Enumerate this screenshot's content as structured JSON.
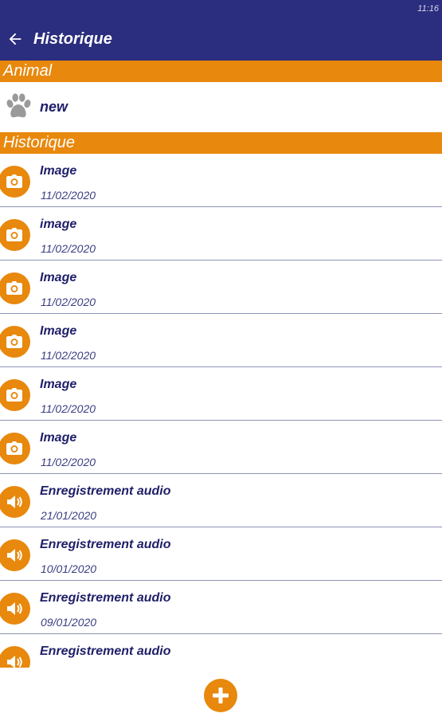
{
  "status_bar": {
    "time": "11:16"
  },
  "app_bar": {
    "title": "Historique"
  },
  "sections": {
    "animal": "Animal",
    "history": "Historique"
  },
  "animal": {
    "name": "new",
    "icon": "paw-icon"
  },
  "history": [
    {
      "type": "image",
      "icon": "camera-icon",
      "title": "Image",
      "date": "11/02/2020"
    },
    {
      "type": "image",
      "icon": "camera-icon",
      "title": "image",
      "date": "11/02/2020"
    },
    {
      "type": "image",
      "icon": "camera-icon",
      "title": "Image",
      "date": "11/02/2020"
    },
    {
      "type": "image",
      "icon": "camera-icon",
      "title": "Image",
      "date": "11/02/2020"
    },
    {
      "type": "image",
      "icon": "camera-icon",
      "title": "Image",
      "date": "11/02/2020"
    },
    {
      "type": "image",
      "icon": "camera-icon",
      "title": "Image",
      "date": "11/02/2020"
    },
    {
      "type": "audio",
      "icon": "speaker-icon",
      "title": "Enregistrement audio",
      "date": "21/01/2020"
    },
    {
      "type": "audio",
      "icon": "speaker-icon",
      "title": "Enregistrement audio",
      "date": "10/01/2020"
    },
    {
      "type": "audio",
      "icon": "speaker-icon",
      "title": "Enregistrement audio",
      "date": "09/01/2020"
    },
    {
      "type": "audio",
      "icon": "speaker-icon",
      "title": "Enregistrement audio",
      "date": ""
    }
  ],
  "colors": {
    "primary": "#2b2d7e",
    "accent": "#e8880c",
    "text": "#20206a"
  }
}
